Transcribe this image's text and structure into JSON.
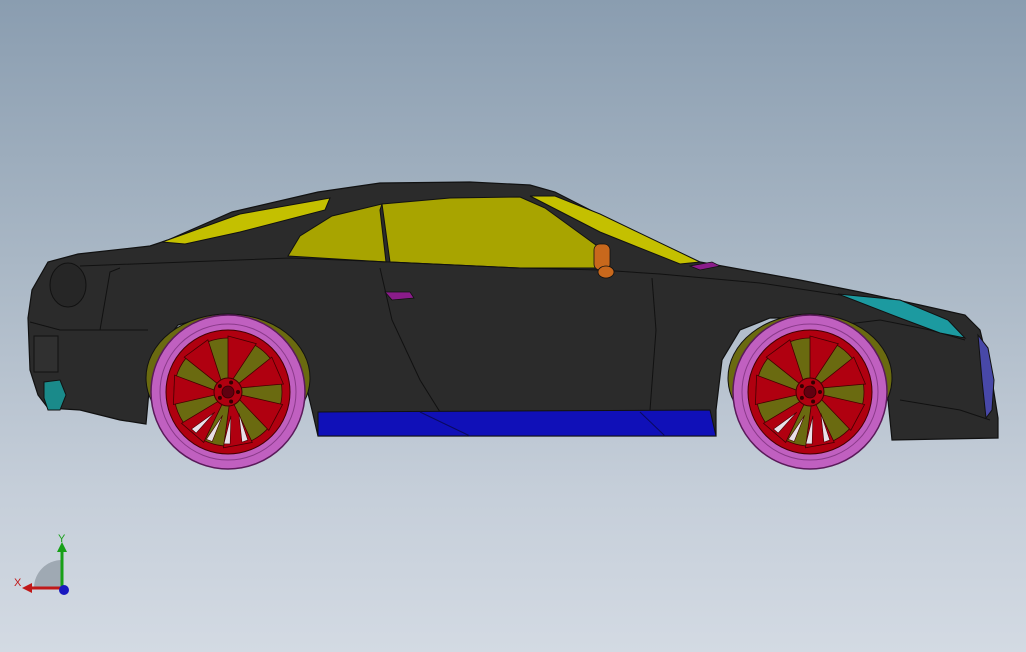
{
  "viewport": {
    "background_top": "#8a9db0",
    "background_bottom": "#d3dae3"
  },
  "model": {
    "colors": {
      "body": "#2b2b2b",
      "glass": "#a8a400",
      "roof_trim": "#c4c000",
      "sill": "#1010b8",
      "tire": "#c060c0",
      "rim": "#b00010",
      "wheel_well": "#6a6a10",
      "mirror": "#c8681c",
      "door_handle": "#8a1c8a",
      "headlight": "#1c9aa0",
      "grille": "#4848a8",
      "fog_light": "#1a8a8a"
    }
  },
  "triad": {
    "x_label": "X",
    "y_label": "Y",
    "x_color": "#c01818",
    "y_color": "#18a018",
    "z_color": "#1818c0"
  }
}
